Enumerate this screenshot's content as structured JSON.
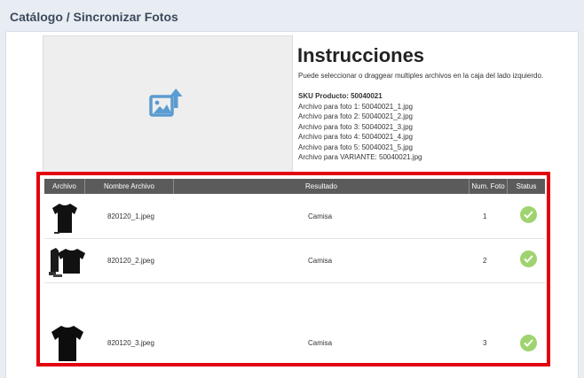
{
  "page": {
    "title": "Catálogo / Sincronizar Fotos"
  },
  "dropzone": {
    "icon": "image-upload-icon"
  },
  "instructions": {
    "title": "Instrucciones",
    "description": "Puede seleccionar o draggear multiples archivos en la caja del lado izquierdo.",
    "sku_label": "SKU Producto: 50040021",
    "lines": [
      "Archivo para foto 1: 50040021_1.jpg",
      "Archivo para foto 2: 50040021_2.jpg",
      "Archivo para foto 3: 50040021_3.jpg",
      "Archivo para foto 4: 50040021_4.jpg",
      "Archivo para foto 5: 50040021_5.jpg",
      "Archivo para VARIANTE: 50040021.jpg"
    ]
  },
  "table": {
    "headers": [
      "Archivo",
      "Nombre Archivo",
      "Resultado",
      "Num. Foto",
      "Status"
    ],
    "rows": [
      {
        "filename": "820120_1.jpeg",
        "result": "Camisa",
        "num": "1",
        "status_icon": "check-circle-icon"
      },
      {
        "filename": "820120_2.jpeg",
        "result": "Camisa",
        "num": "2",
        "status_icon": "check-circle-icon"
      },
      {
        "filename": "820120_3.jpeg",
        "result": "Camisa",
        "num": "3",
        "status_icon": "check-circle-icon"
      }
    ]
  },
  "colors": {
    "highlight_border": "#e3000f",
    "header_bg": "#5b5b5b",
    "status_ok": "#9fd36f",
    "icon_blue": "#5b9bd1"
  }
}
